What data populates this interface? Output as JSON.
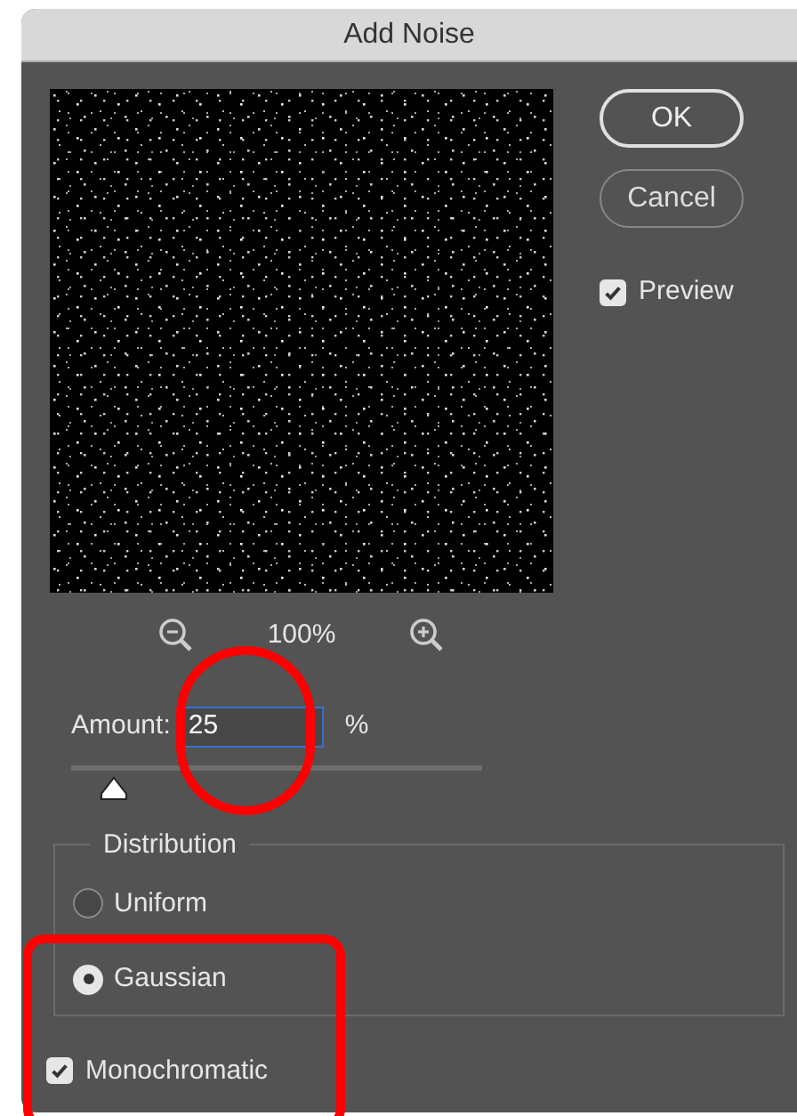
{
  "window": {
    "title": "Add Noise"
  },
  "buttons": [
    {
      "label": "OK",
      "default": true
    },
    {
      "label": "Cancel",
      "default": false
    }
  ],
  "preview": {
    "label": "Preview",
    "checked": true
  },
  "zoom": {
    "reading": "100%"
  },
  "amount": {
    "label": "Amount:",
    "value": "25",
    "unit": "%",
    "level": 0.06
  },
  "distribution": {
    "title": "Distribution",
    "options": [
      {
        "label": "Uniform",
        "selected": false
      },
      {
        "label": "Gaussian",
        "selected": true
      }
    ]
  },
  "monochromatic": {
    "label": "Monochromatic",
    "checked": true
  }
}
